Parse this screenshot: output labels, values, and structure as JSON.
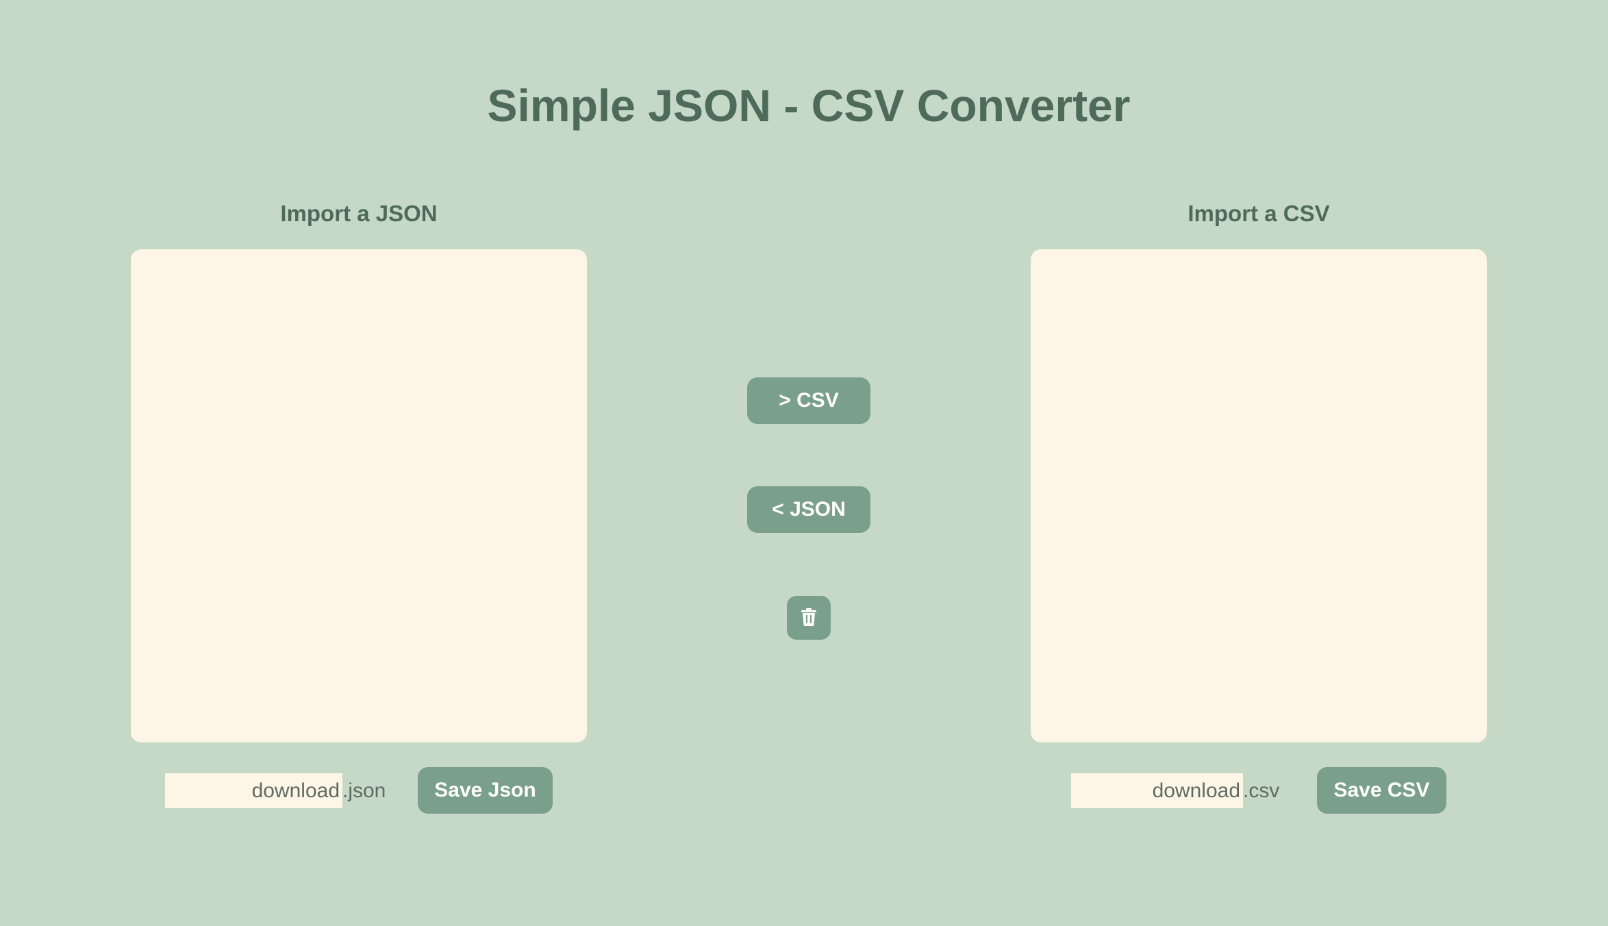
{
  "header": {
    "title": "Simple JSON - CSV Converter"
  },
  "json_panel": {
    "label": "Import a JSON",
    "textarea_value": "",
    "filename_value": "download",
    "extension": ".json",
    "save_label": "Save Json"
  },
  "csv_panel": {
    "label": "Import a CSV",
    "textarea_value": "",
    "filename_value": "download",
    "extension": ".csv",
    "save_label": "Save CSV"
  },
  "controls": {
    "to_csv_label": "> CSV",
    "to_json_label": "< JSON",
    "clear_icon": "trash-icon"
  },
  "colors": {
    "background": "#c5d9c6",
    "text": "#4e6a5a",
    "button": "#7a9f8b",
    "panel": "#fdf5e6"
  }
}
